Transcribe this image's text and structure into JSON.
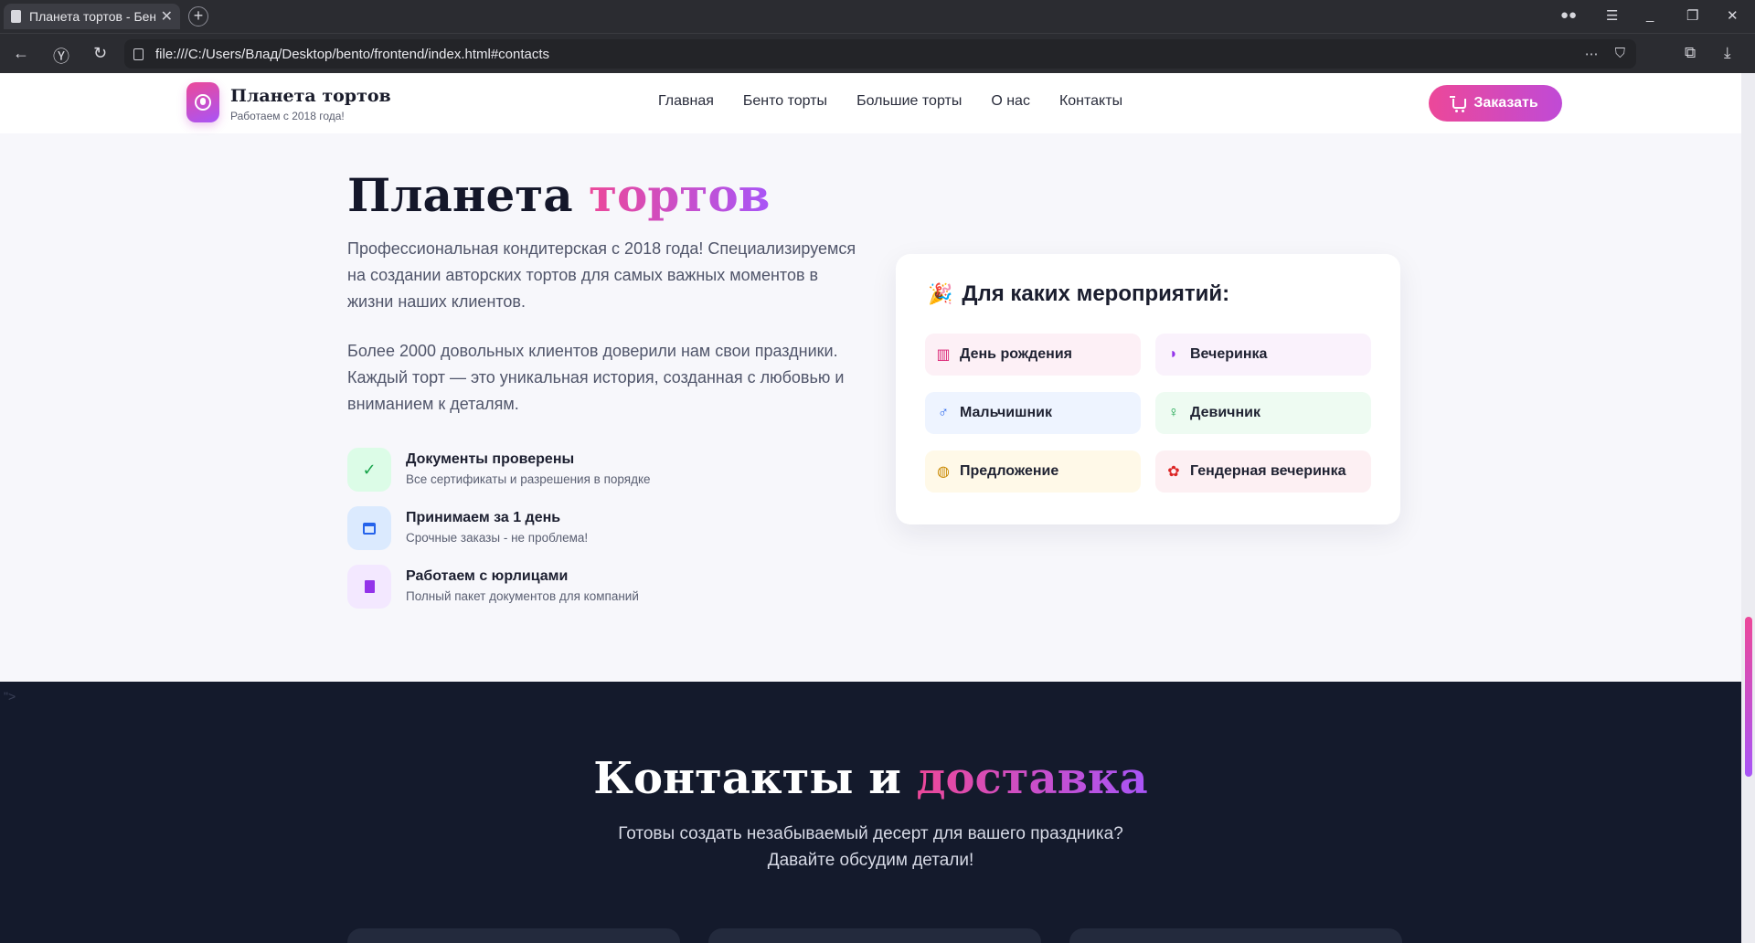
{
  "browser": {
    "tab_title": "Планета тортов - Бенто",
    "url": "file:///C:/Users/Влад/Desktop/bento/frontend/index.html#contacts",
    "icons": [
      "back-icon",
      "yandex-icon",
      "reload-icon",
      "page-icon",
      "more-icon",
      "bookmark-icon",
      "collections-icon",
      "download-icon",
      "incognito-icon",
      "menu-icon",
      "minimize-icon",
      "restore-icon",
      "close-icon"
    ]
  },
  "header": {
    "brand": "Планета тортов",
    "brand_sub": "Работаем с 2018 года!",
    "nav": [
      "Главная",
      "Бенто торты",
      "Большие торты",
      "О нас",
      "Контакты"
    ],
    "order_label": "Заказать"
  },
  "about": {
    "title_main": "Планета ",
    "title_accent": "тортов",
    "p1": "Профессиональная кондитерская с 2018 года! Специализируемся на создании авторских тортов для самых важных моментов в жизни наших клиентов.",
    "p2": "Более 2000 довольных клиентов доверили нам свои праздники. Каждый торт — это уникальная история, созданная с любовью и вниманием к деталям.",
    "features": [
      {
        "title": "Документы проверены",
        "subtitle": "Все сертификаты и разрешения в порядке",
        "icon": "check-icon"
      },
      {
        "title": "Принимаем за 1 день",
        "subtitle": "Срочные заказы - не проблема!",
        "icon": "calendar-icon"
      },
      {
        "title": "Работаем с юрлицами",
        "subtitle": "Полный пакет документов для компаний",
        "icon": "building-icon"
      }
    ]
  },
  "events": {
    "title": "Для каких мероприятий:",
    "items": [
      {
        "label": "День рождения",
        "icon": "birthday-cake-icon"
      },
      {
        "label": "Вечеринка",
        "icon": "party-mask-icon"
      },
      {
        "label": "Мальчишник",
        "icon": "male-icon"
      },
      {
        "label": "Девичник",
        "icon": "female-icon"
      },
      {
        "label": "Предложение",
        "icon": "ring-icon"
      },
      {
        "label": "Гендерная вечеринка",
        "icon": "baby-icon"
      }
    ]
  },
  "contacts": {
    "title_main": "Контакты и ",
    "title_accent": "доставка",
    "sub_line1": "Готовы создать незабываемый десерт для вашего праздника?",
    "sub_line2": "Давайте обсудим детали!",
    "stray": "\">"
  },
  "colors": {
    "accent_pink": "#ec4899",
    "accent_purple": "#a855f7",
    "dark_section": "#141a2c"
  }
}
